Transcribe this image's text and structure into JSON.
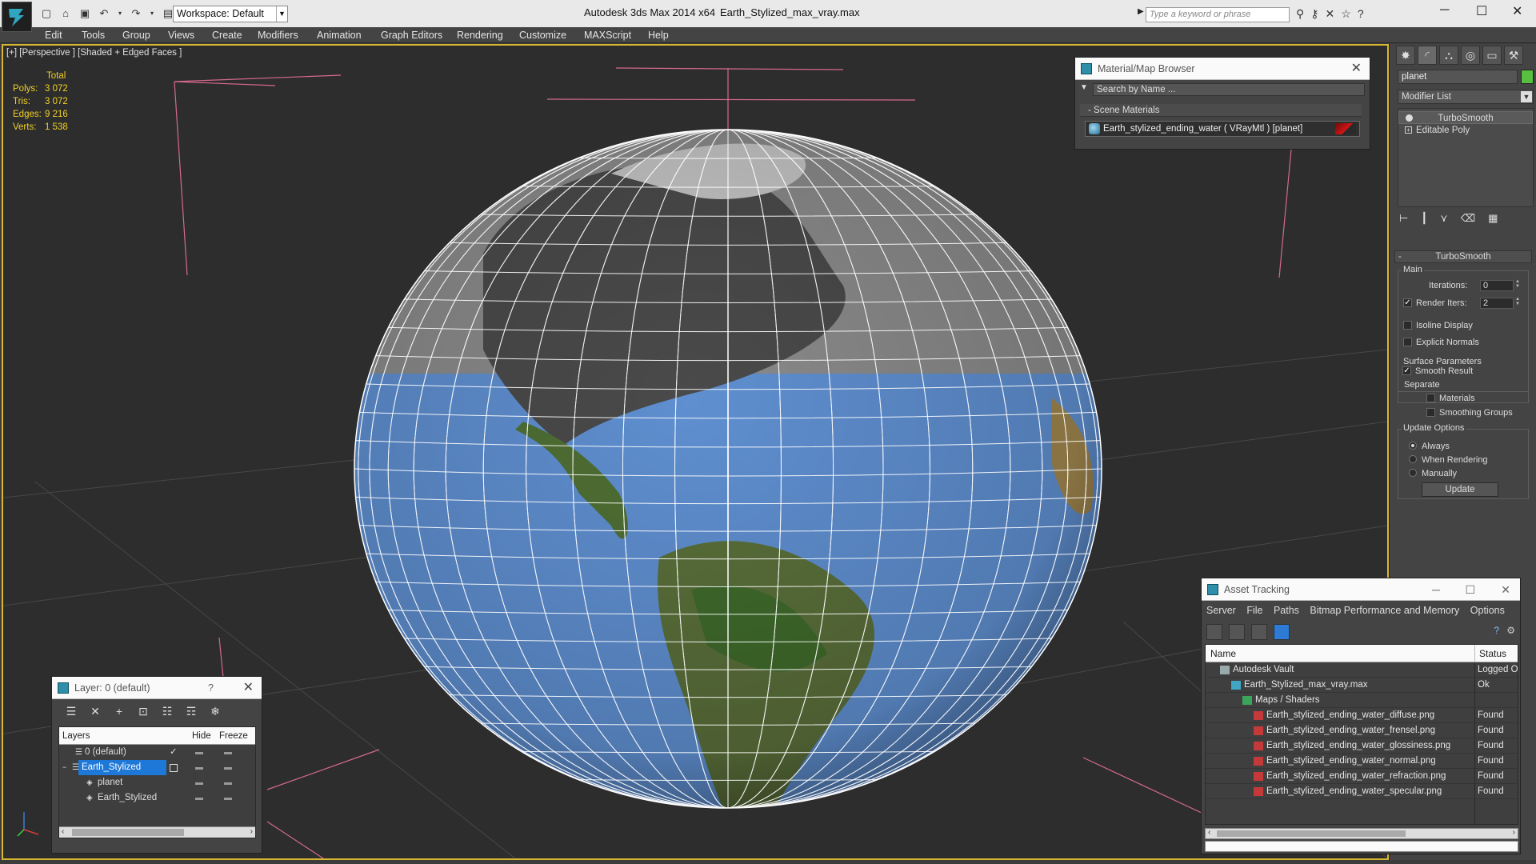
{
  "titlebar": {
    "workspace": "Workspace: Default",
    "app_title": "Autodesk 3ds Max  2014 x64",
    "file_title": "Earth_Stylized_max_vray.max",
    "search_placeholder": "Type a keyword or phrase"
  },
  "menu": [
    "Edit",
    "Tools",
    "Group",
    "Views",
    "Create",
    "Modifiers",
    "Animation",
    "Graph Editors",
    "Rendering",
    "Customize",
    "MAXScript",
    "Help"
  ],
  "viewport": {
    "label": "[+] [Perspective ] [Shaded + Edged Faces ]",
    "stats": {
      "header": "Total",
      "rows": [
        {
          "key": "Polys:",
          "value": "3 072"
        },
        {
          "key": "Tris:",
          "value": "3 072"
        },
        {
          "key": "Edges:",
          "value": "9 216"
        },
        {
          "key": "Verts:",
          "value": "1 538"
        }
      ]
    }
  },
  "material_browser": {
    "title": "Material/Map Browser",
    "search_placeholder": "Search by Name ...",
    "section": "- Scene Materials",
    "item": "Earth_stylized_ending_water  ( VRayMtl ) [planet]"
  },
  "command_panel": {
    "object_name": "planet",
    "object_color": "#58c040",
    "modifier_list": "Modifier List",
    "stack": [
      "TurboSmooth",
      "Editable Poly"
    ],
    "rollout_title": "TurboSmooth",
    "main_group": "Main",
    "iterations_label": "Iterations:",
    "iterations_value": "0",
    "render_iters_label": "Render Iters:",
    "render_iters_value": "2",
    "render_iters_checked": true,
    "isoline_label": "Isoline Display",
    "explicit_normals_label": "Explicit Normals",
    "surface_group": "Surface Parameters",
    "smooth_result_label": "Smooth Result",
    "separate_label": "Separate",
    "materials_label": "Materials",
    "smoothing_groups_label": "Smoothing Groups",
    "update_group": "Update Options",
    "update_options": [
      "Always",
      "When Rendering",
      "Manually"
    ],
    "update_selected": "Always",
    "update_button": "Update"
  },
  "layer_explorer": {
    "title": "Layer: 0 (default)",
    "help": "?",
    "columns": [
      "Layers",
      "Hide",
      "Freeze"
    ],
    "rows": [
      {
        "name": "0 (default)",
        "indent": 1,
        "selected": false,
        "active": true
      },
      {
        "name": "Earth_Stylized",
        "indent": 1,
        "selected": true,
        "active": false
      },
      {
        "name": "planet",
        "indent": 2,
        "selected": false,
        "active": false
      },
      {
        "name": "Earth_Stylized",
        "indent": 2,
        "selected": false,
        "active": false
      }
    ]
  },
  "asset_tracking": {
    "title": "Asset Tracking",
    "menu": [
      "Server",
      "File",
      "Paths",
      "Bitmap Performance and Memory",
      "Options"
    ],
    "columns": [
      "Name",
      "Status"
    ],
    "rows": [
      {
        "name": "Autodesk Vault",
        "status": "Logged Ou",
        "level": 1,
        "icon": "vault"
      },
      {
        "name": "Earth_Stylized_max_vray.max",
        "status": "Ok",
        "level": 2,
        "icon": "max"
      },
      {
        "name": "Maps / Shaders",
        "status": "",
        "level": 3,
        "icon": "maps"
      },
      {
        "name": "Earth_stylized_ending_water_diffuse.png",
        "status": "Found",
        "level": 4,
        "icon": "png"
      },
      {
        "name": "Earth_stylized_ending_water_frensel.png",
        "status": "Found",
        "level": 4,
        "icon": "png"
      },
      {
        "name": "Earth_stylized_ending_water_glossiness.png",
        "status": "Found",
        "level": 4,
        "icon": "png"
      },
      {
        "name": "Earth_stylized_ending_water_normal.png",
        "status": "Found",
        "level": 4,
        "icon": "png"
      },
      {
        "name": "Earth_stylized_ending_water_refraction.png",
        "status": "Found",
        "level": 4,
        "icon": "png"
      },
      {
        "name": "Earth_stylized_ending_water_specular.png",
        "status": "Found",
        "level": 4,
        "icon": "png"
      }
    ]
  }
}
